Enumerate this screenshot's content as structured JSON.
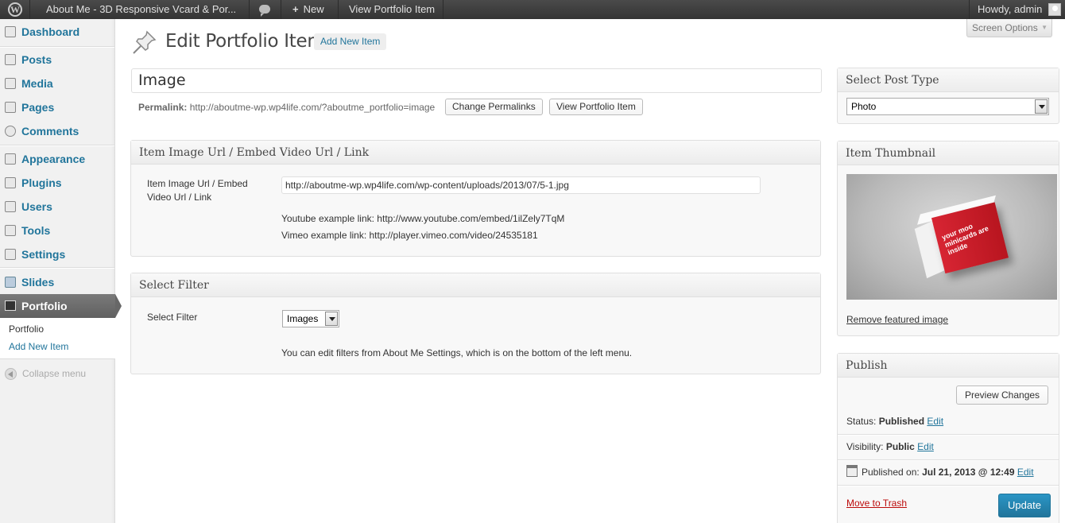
{
  "adminbar": {
    "site_name": "About Me - 3D Responsive Vcard & Por...",
    "new_label": "New",
    "view_label": "View Portfolio Item",
    "howdy": "Howdy, admin"
  },
  "sidebar": {
    "items": [
      {
        "label": "Dashboard"
      },
      {
        "label": "Posts"
      },
      {
        "label": "Media"
      },
      {
        "label": "Pages"
      },
      {
        "label": "Comments"
      },
      {
        "label": "Appearance"
      },
      {
        "label": "Plugins"
      },
      {
        "label": "Users"
      },
      {
        "label": "Tools"
      },
      {
        "label": "Settings"
      },
      {
        "label": "Slides"
      }
    ],
    "current": "Portfolio",
    "submenu": {
      "portfolio": "Portfolio",
      "add_new": "Add New Item"
    },
    "collapse": "Collapse menu"
  },
  "header": {
    "title": "Edit Portfolio Item",
    "add_new": "Add New Item",
    "screen_options": "Screen Options"
  },
  "post": {
    "title_value": "Image",
    "permalink_label": "Permalink:",
    "permalink_url": "http://aboutme-wp.wp4life.com/?aboutme_portfolio=image",
    "change_permalinks": "Change Permalinks",
    "view_item": "View Portfolio Item"
  },
  "image_box": {
    "title": "Item Image Url / Embed Video Url / Link",
    "field_label": "Item Image Url / Embed Video Url / Link",
    "field_value": "http://aboutme-wp.wp4life.com/wp-content/uploads/2013/07/5-1.jpg",
    "youtube_hint": "Youtube example link: http://www.youtube.com/embed/1ilZely7TqM",
    "vimeo_hint": "Vimeo example link: http://player.vimeo.com/video/24535181"
  },
  "filter_box": {
    "title": "Select Filter",
    "field_label": "Select Filter",
    "selected": "Images",
    "hint": "You can edit filters from About Me Settings, which is on the bottom of the left menu."
  },
  "post_type_box": {
    "title": "Select Post Type",
    "selected": "Photo"
  },
  "thumbnail_box": {
    "title": "Item Thumbnail",
    "image_text": "your moo minicards are inside",
    "remove_link": "Remove featured image"
  },
  "publish_box": {
    "title": "Publish",
    "preview": "Preview Changes",
    "status_label": "Status:",
    "status_value": "Published",
    "visibility_label": "Visibility:",
    "visibility_value": "Public",
    "published_label": "Published on:",
    "published_value": "Jul 21, 2013 @ 12:49",
    "edit": "Edit",
    "trash": "Move to Trash",
    "update": "Update"
  },
  "colors": {
    "link": "#21759b",
    "admin_bar": "#464646",
    "primary_button": "#21759b",
    "trash": "#bc0b0b"
  }
}
